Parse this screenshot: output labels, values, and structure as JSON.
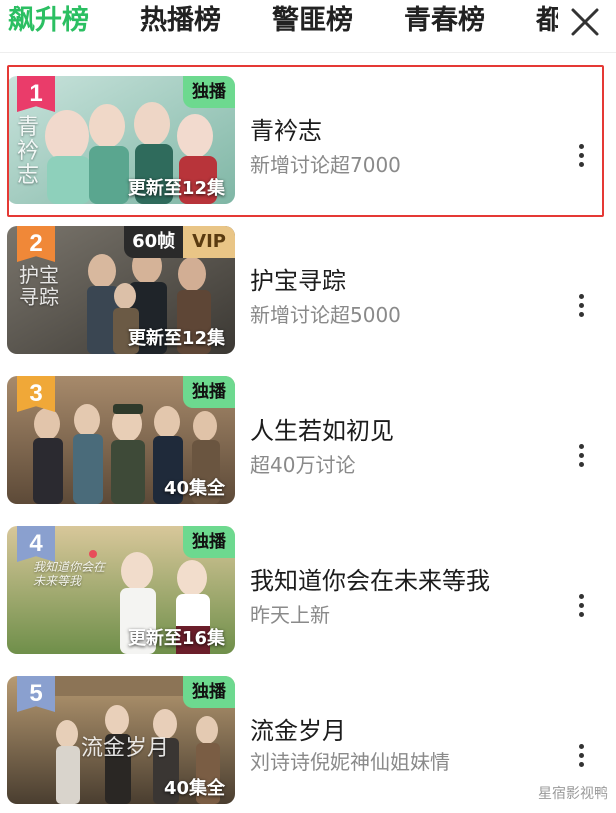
{
  "tabs": [
    {
      "label": "飙升榜",
      "active": true
    },
    {
      "label": "热播榜",
      "active": false
    },
    {
      "label": "警匪榜",
      "active": false
    },
    {
      "label": "青春榜",
      "active": false
    },
    {
      "label": "都",
      "active": false
    }
  ],
  "close_icon": "close-icon",
  "items": [
    {
      "rank": "1",
      "rank_color": "#ea3c6a",
      "title": "青衿志",
      "subtitle": "新增讨论超7000",
      "badge": "独播",
      "episodes": "更新至12集",
      "poster_text": "青衿志"
    },
    {
      "rank": "2",
      "rank_color": "#f08838",
      "title": "护宝寻踪",
      "subtitle": "新增讨论超5000",
      "badge_fps": "60帧",
      "badge_vip": "VIP",
      "episodes": "更新至12集",
      "poster_text": "护宝寻踪"
    },
    {
      "rank": "3",
      "rank_color": "#f0a838",
      "title": "人生若如初见",
      "subtitle": "超40万讨论",
      "badge": "独播",
      "episodes": "40集全"
    },
    {
      "rank": "4",
      "rank_color": "#8aa0cf",
      "title": "我知道你会在未来等我",
      "subtitle": "昨天上新",
      "badge": "独播",
      "episodes": "更新至16集",
      "poster_text": "我知道你会在未来等我"
    },
    {
      "rank": "5",
      "rank_color": "#8aa0cf",
      "title": "流金岁月",
      "subtitle": "刘诗诗倪妮神仙姐妹情",
      "badge": "独播",
      "episodes": "40集全",
      "poster_text": "流金岁月"
    }
  ],
  "watermark": "星宿影视鸭",
  "colors": {
    "accent": "#2bbf62",
    "highlight_border": "#e53935",
    "badge_bg": "#6dd98f"
  }
}
